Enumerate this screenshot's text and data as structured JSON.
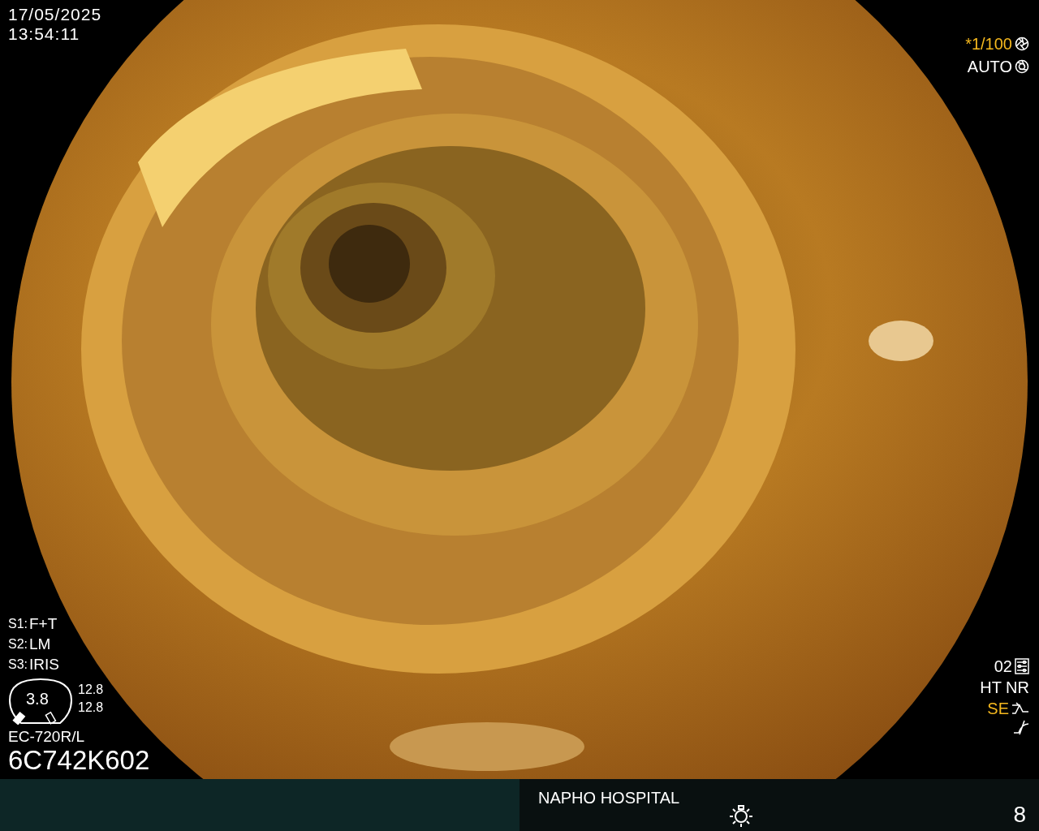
{
  "timestamp": {
    "date": "17/05/2025",
    "time": "13:54:11"
  },
  "shutter": {
    "speed": "*1/100",
    "mode": "AUTO"
  },
  "switches": [
    {
      "label": "S1:",
      "value": "F+T"
    },
    {
      "label": "S2:",
      "value": "LM"
    },
    {
      "label": "S3:",
      "value": "IRIS"
    }
  ],
  "gauge": {
    "value": "3.8",
    "readings": [
      "12.8",
      "12.8"
    ]
  },
  "scope": {
    "model": "EC-720R/L",
    "serial": "6C742K602"
  },
  "settings": {
    "preset": "02",
    "modes": "HT NR",
    "enhancement": "SE"
  },
  "status_bar": {
    "hospital": "NAPHO HOSPITAL",
    "counter": "8"
  }
}
